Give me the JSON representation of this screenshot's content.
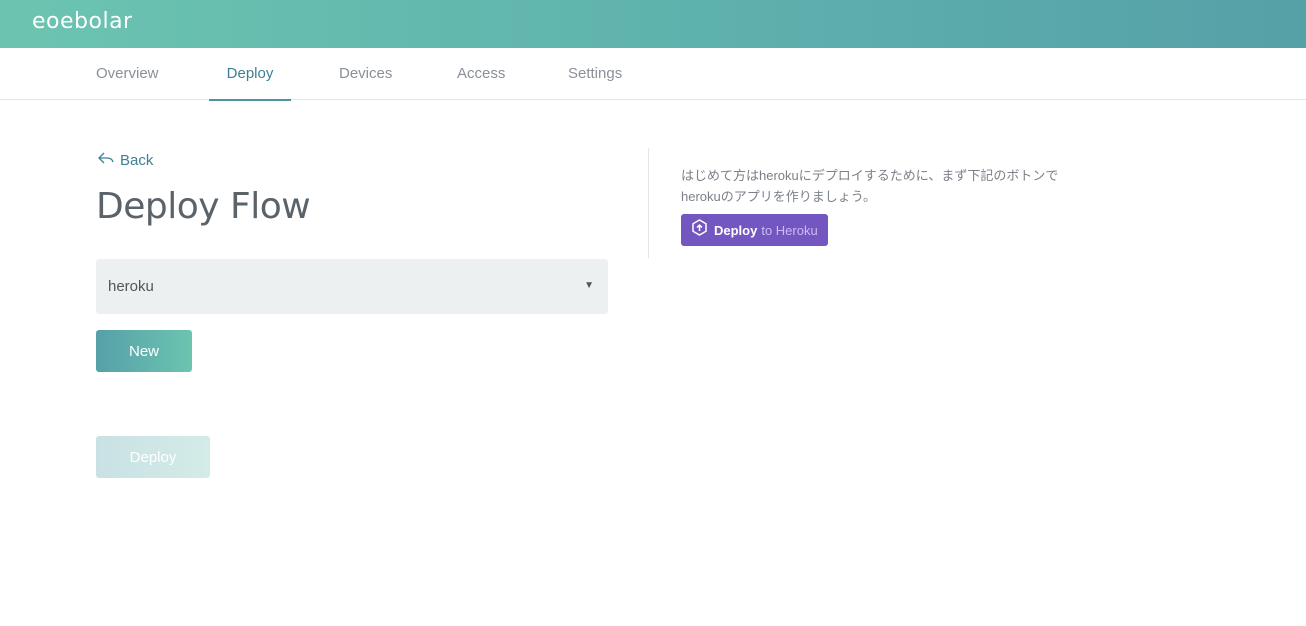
{
  "header": {
    "logo_text": "eoebolar"
  },
  "tabs": [
    {
      "label": "Overview",
      "active": false
    },
    {
      "label": "Deploy",
      "active": true
    },
    {
      "label": "Devices",
      "active": false
    },
    {
      "label": "Access",
      "active": false
    },
    {
      "label": "Settings",
      "active": false
    }
  ],
  "main": {
    "back_label": "Back",
    "title": "Deploy Flow",
    "select": {
      "value": "heroku"
    },
    "new_label": "New",
    "deploy_label": "Deploy"
  },
  "side": {
    "info_line1": "はじめて方はherokuにデプロイするために、まず下記のボトンで",
    "info_line2": "herokuのアプリを作りましょう。",
    "heroku_button": {
      "part1": "Deploy",
      "part2": "to Heroku"
    }
  },
  "colors": {
    "brand_start": "#6cc4b0",
    "brand_end": "#56a0a8",
    "active_tab": "#3d7f93",
    "heroku_purple": "#7356c0"
  },
  "icons": {
    "back": "back-arrow-icon",
    "caret": "caret-down-icon",
    "heroku": "heroku-upload-icon"
  }
}
